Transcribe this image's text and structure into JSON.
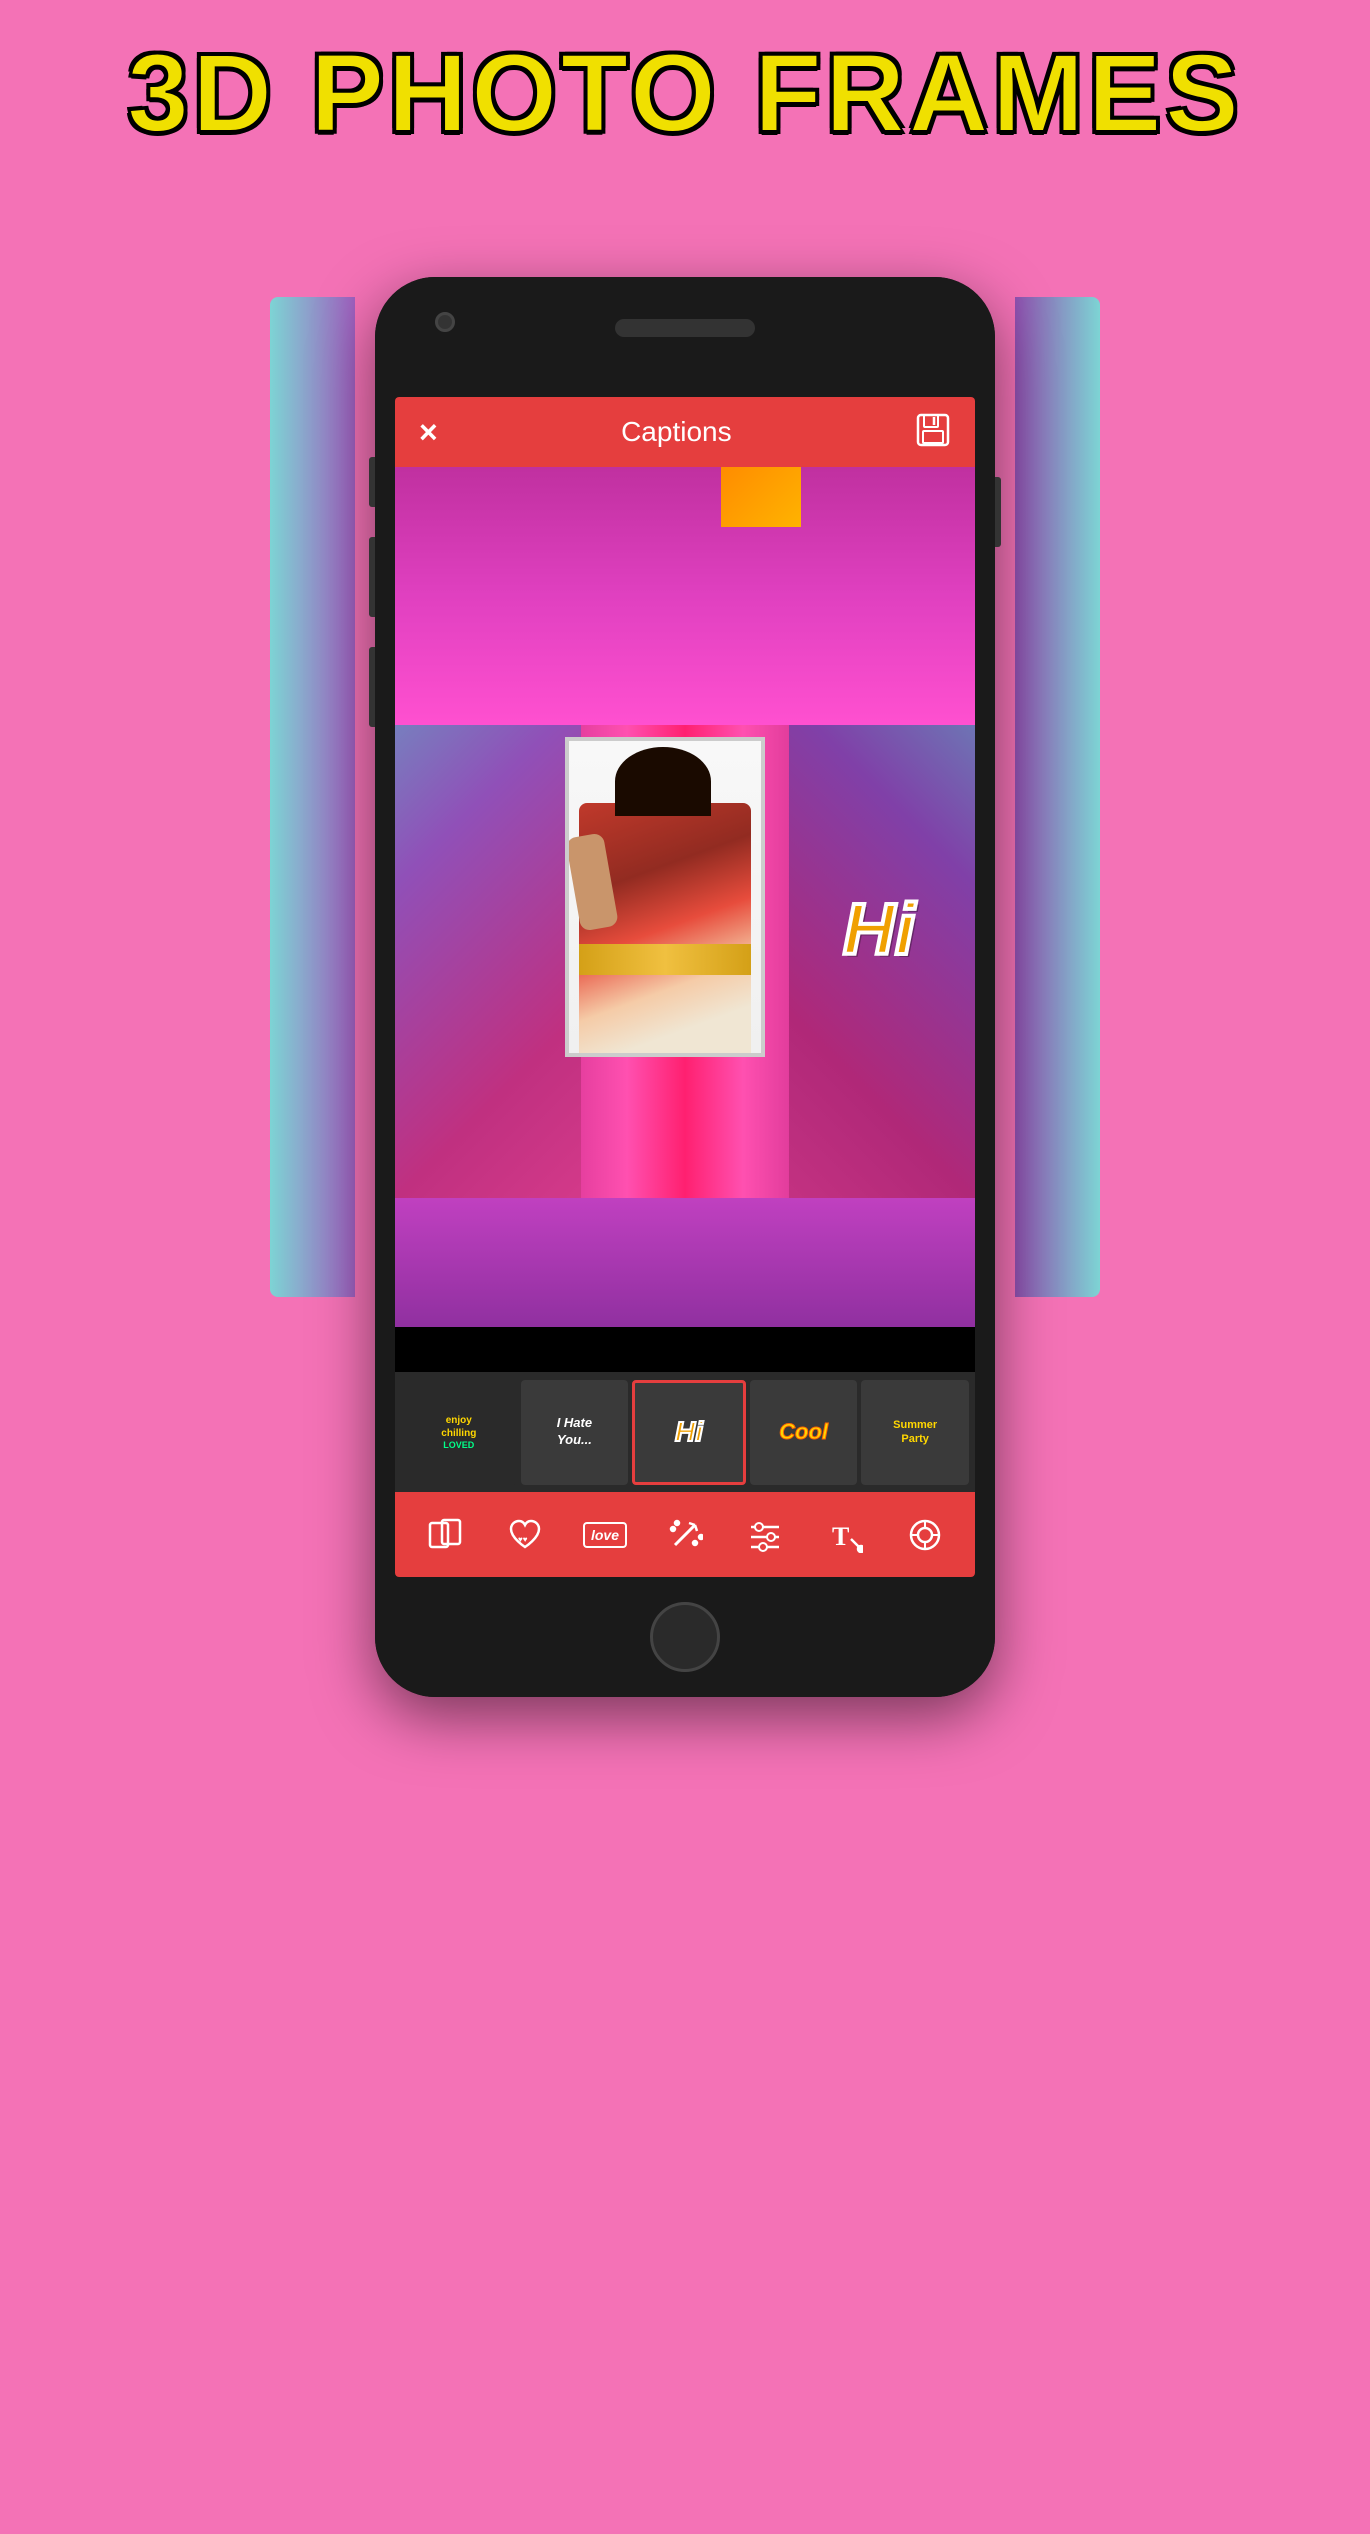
{
  "title": "3D PHOTO FRAMES",
  "app": {
    "header": {
      "close_label": "×",
      "title": "Captions",
      "save_tooltip": "Save"
    },
    "stickers": [
      {
        "id": "enjoy",
        "label": "enjoy\nchilling",
        "active": false
      },
      {
        "id": "hate-you",
        "label": "I Hate\nYou...",
        "active": false
      },
      {
        "id": "hi",
        "label": "Hi",
        "active": true
      },
      {
        "id": "cool",
        "label": "Cool",
        "active": false
      },
      {
        "id": "summer-party",
        "label": "Summer\nParty",
        "active": false
      }
    ],
    "tools": [
      {
        "id": "frames",
        "icon": "frames"
      },
      {
        "id": "stickers-hearts",
        "icon": "heart"
      },
      {
        "id": "stickers-love",
        "icon": "love-text"
      },
      {
        "id": "magic",
        "icon": "magic-wand"
      },
      {
        "id": "adjust",
        "icon": "sliders"
      },
      {
        "id": "text",
        "icon": "text-T"
      },
      {
        "id": "target",
        "icon": "target"
      }
    ],
    "canvas_sticker": {
      "text": "Hi",
      "color": "#f0a000"
    }
  },
  "colors": {
    "background": "#f472b6",
    "header_bar": "#e53e3e",
    "tool_bar": "#e53e3e",
    "sticker_bar": "#2a2a2a",
    "title_yellow": "#f0e000",
    "title_outline": "#000000"
  }
}
